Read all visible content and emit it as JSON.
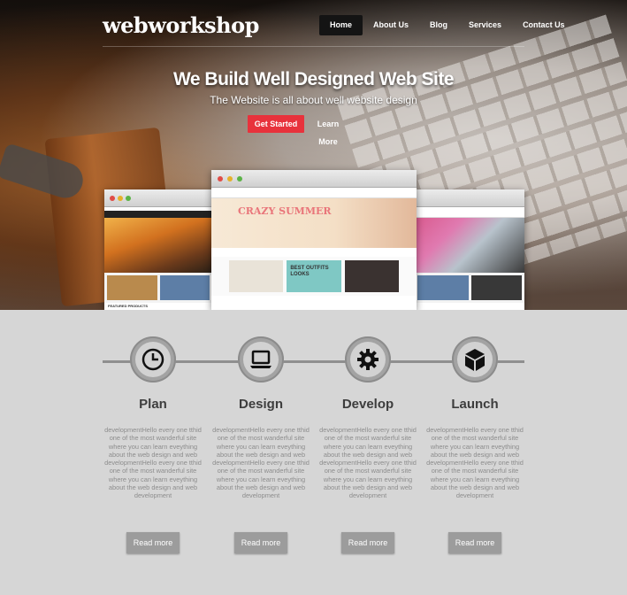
{
  "brand": {
    "logo": "webworkshop"
  },
  "nav": {
    "items": [
      {
        "label": "Home",
        "active": true
      },
      {
        "label": "About Us",
        "active": false
      },
      {
        "label": "Blog",
        "active": false
      },
      {
        "label": "Services",
        "active": false
      },
      {
        "label": "Contact Us",
        "active": false
      }
    ]
  },
  "hero": {
    "title": "We Build Well Designed Web Site",
    "subtitle": "The Website is all about well website design",
    "primary_button": "Get Started",
    "secondary_button": "Learn More"
  },
  "mockups": {
    "left_caption": "FEATURED PRODUCTS",
    "center_banner": "CRAZY SUMMER",
    "center_tile": "BEST OUTFITS LOOKS"
  },
  "steps": [
    {
      "icon": "clock-icon",
      "title": "Plan",
      "text": "developmentHello every one tthid one of the most wanderful site where you can learn eveything about the web design and web developmentHello every one tthid one of the most wanderful site where you can learn eveything about the web design and web development",
      "button": "Read more"
    },
    {
      "icon": "laptop-icon",
      "title": "Design",
      "text": "developmentHello every one tthid one of the most wanderful site where you can learn eveything about the web design and web developmentHello every one tthid one of the most wanderful site where you can learn eveything about the web design and web development",
      "button": "Read more"
    },
    {
      "icon": "gear-icon",
      "title": "Develop",
      "text": "developmentHello every one tthid one of the most wanderful site where you can learn eveything about the web design and web developmentHello every one tthid one of the most wanderful site where you can learn eveything about the web design and web development",
      "button": "Read more"
    },
    {
      "icon": "cube-icon",
      "title": "Launch",
      "text": "developmentHello every one tthid one of the most wanderful site where you can learn eveything about the web design and web developmentHello every one tthid one of the most wanderful site where you can learn eveything about the web design and web development",
      "button": "Read more"
    }
  ],
  "colors": {
    "accent": "#e8323c",
    "nav_active_bg": "#141414",
    "features_bg": "#d6d6d6",
    "button_grey": "#9c9c9c"
  }
}
